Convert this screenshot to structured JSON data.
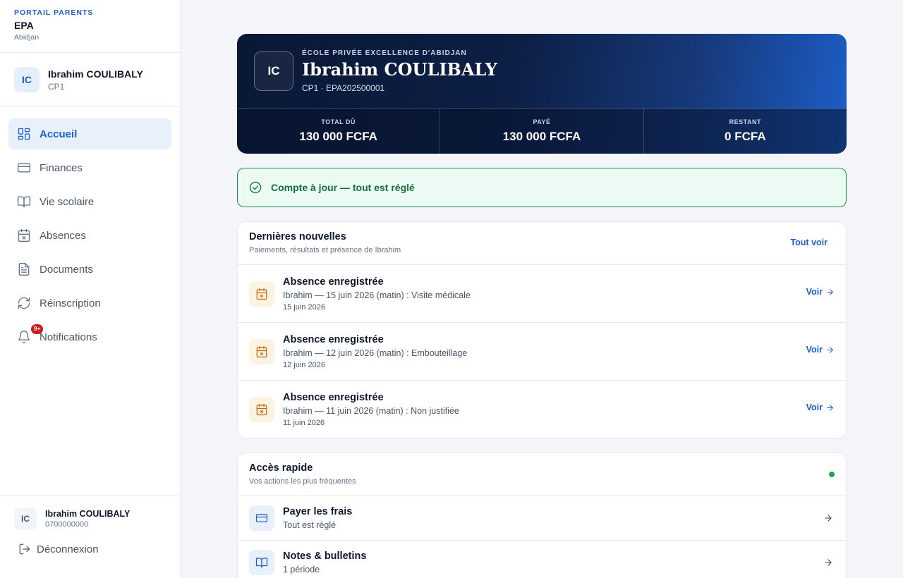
{
  "brand": {
    "sup": "PORTAIL PARENTS",
    "name": "EPA",
    "city": "Abidjan"
  },
  "student": {
    "initials": "IC",
    "name": "Ibrahim COULIBALY",
    "class": "CP1"
  },
  "nav": [
    {
      "label": "Accueil",
      "icon": "dashboard-icon",
      "active": true
    },
    {
      "label": "Finances",
      "icon": "credit-card-icon"
    },
    {
      "label": "Vie scolaire",
      "icon": "book-open-icon"
    },
    {
      "label": "Absences",
      "icon": "calendar-x-icon"
    },
    {
      "label": "Documents",
      "icon": "file-text-icon"
    },
    {
      "label": "Réinscription",
      "icon": "refresh-icon"
    },
    {
      "label": "Notifications",
      "icon": "bell-icon",
      "badge": "9+"
    }
  ],
  "footer": {
    "initials": "IC",
    "name": "Ibrahim COULIBALY",
    "phone": "0700000000",
    "logout": "Déconnexion"
  },
  "hero": {
    "initials": "IC",
    "school": "ÉCOLE PRIVÉE EXCELLENCE D'ABIDJAN",
    "name": "Ibrahim COULIBALY",
    "meta": "CP1 · EPA202500001",
    "stats": [
      {
        "label": "TOTAL DÛ",
        "value": "130 000 FCFA"
      },
      {
        "label": "PAYÉ",
        "value": "130 000 FCFA"
      },
      {
        "label": "RESTANT",
        "value": "0 FCFA"
      }
    ]
  },
  "alert": {
    "text": "Compte à jour — tout est réglé",
    "icon": "check-circle-icon"
  },
  "news": {
    "title": "Dernières nouvelles",
    "subtitle": "Paiements, résultats et présence de Ibrahim",
    "see_all": "Tout voir",
    "view_label": "Voir",
    "items": [
      {
        "title": "Absence enregistrée",
        "desc": "Ibrahim — 15 juin 2026 (matin) : Visite médicale",
        "date": "15 juin 2026"
      },
      {
        "title": "Absence enregistrée",
        "desc": "Ibrahim — 12 juin 2026 (matin) : Embouteillage",
        "date": "12 juin 2026"
      },
      {
        "title": "Absence enregistrée",
        "desc": "Ibrahim — 11 juin 2026 (matin) : Non justifiée",
        "date": "11 juin 2026"
      }
    ]
  },
  "quick": {
    "title": "Accès rapide",
    "subtitle": "Vos actions les plus fréquentes",
    "items": [
      {
        "title": "Payer les frais",
        "sub": "Tout est réglé",
        "icon": "credit-card-icon"
      },
      {
        "title": "Notes & bulletins",
        "sub": "1 période",
        "icon": "book-open-icon"
      }
    ]
  },
  "colors": {
    "accent": "#1d5ec8",
    "success": "#15803d",
    "danger": "#c81e1e",
    "hero_dark": "#0a1836"
  }
}
